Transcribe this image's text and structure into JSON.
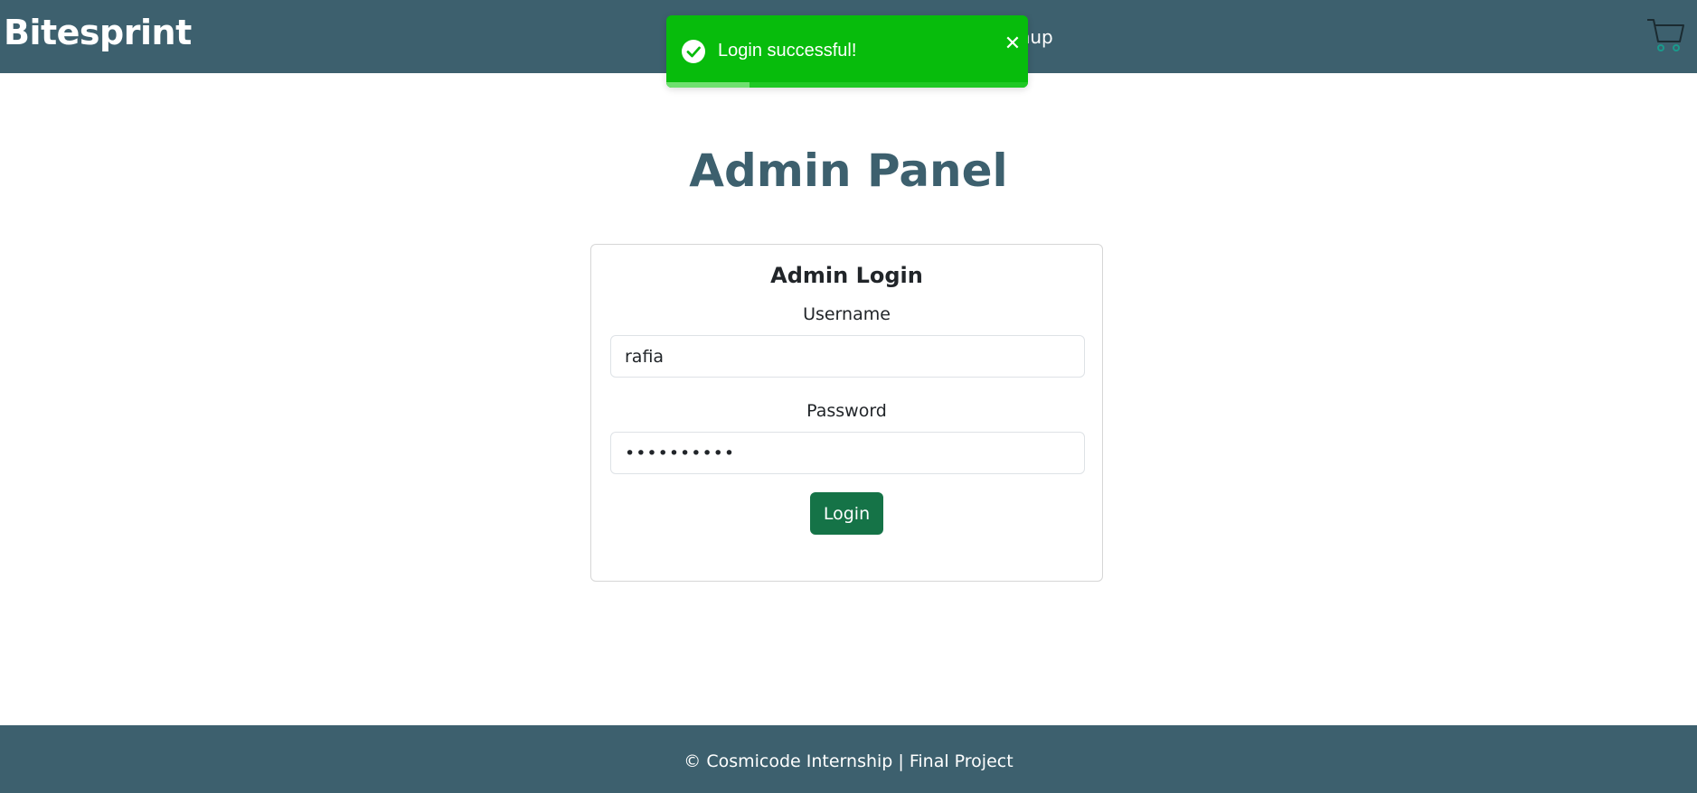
{
  "navbar": {
    "brand": "Bitesprint",
    "signup_partial_label": "gnup",
    "cart_icon": "cart-icon"
  },
  "toast": {
    "message": "Login successful!",
    "close_glyph": "✕",
    "status_icon": "check-circle-icon",
    "progress_fraction": 0.23,
    "color": "#07bc0c"
  },
  "main": {
    "page_title": "Admin Panel",
    "login_card": {
      "title": "Admin Login",
      "username_label": "Username",
      "username_value": "rafia",
      "password_label": "Password",
      "password_value": "••••••••••",
      "login_button": "Login"
    }
  },
  "footer": {
    "text": "© Cosmicode Internship | Final Project"
  },
  "colors": {
    "primary": "#3d606e",
    "success_button": "#157347",
    "toast_green": "#07bc0c"
  }
}
